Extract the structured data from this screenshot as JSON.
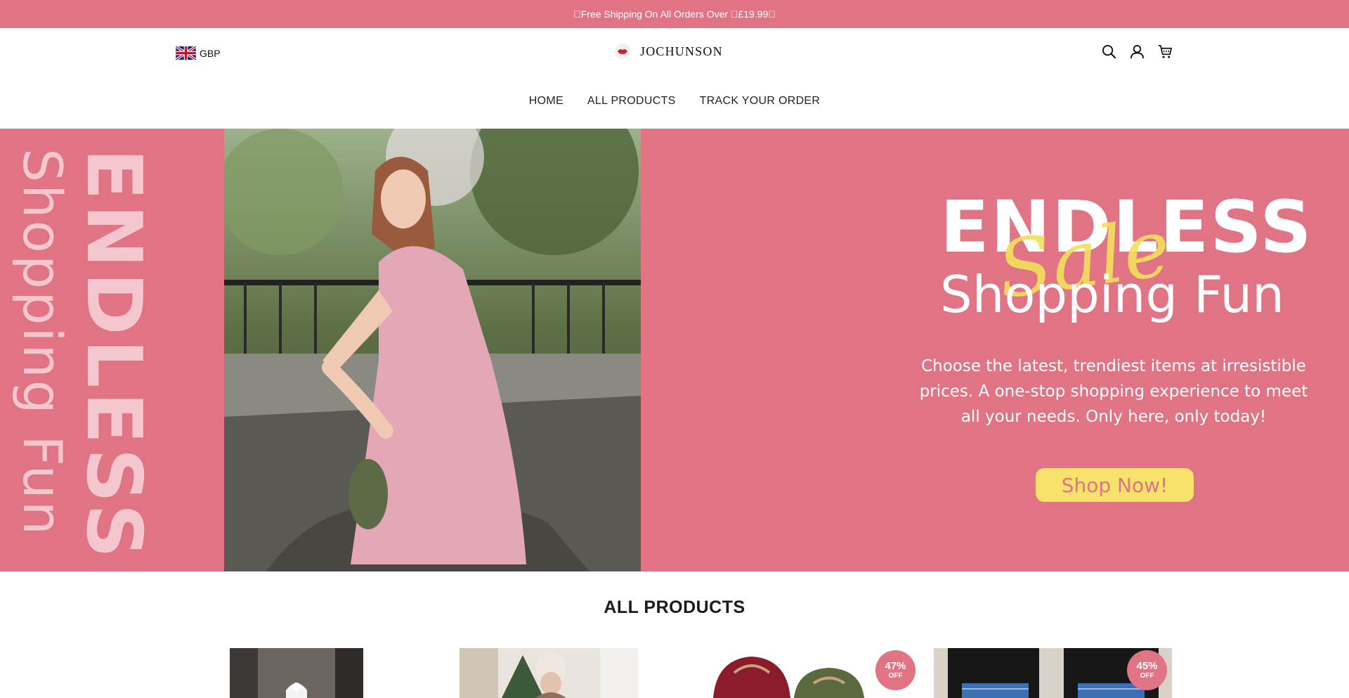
{
  "announcement": "\u0000Free Shipping On All Orders Over \u0000£19.99\u0000",
  "header": {
    "currency": "GBP",
    "logo_text": "JOCHUNSON"
  },
  "nav": {
    "items": [
      {
        "label": "HOME"
      },
      {
        "label": "ALL PRODUCTS"
      },
      {
        "label": "TRACK YOUR ORDER"
      }
    ]
  },
  "hero": {
    "side_big": "ENDLESS",
    "side_small": "Shopping Fun",
    "headline": "ENDLESS",
    "script": "Sale",
    "subheadline": "Shopping Fun",
    "description": "Choose the latest, trendiest items at irresistible prices. A one-stop shopping experience to meet all your needs. Only here, only today!",
    "cta_label": "Shop Now!"
  },
  "products": {
    "section_title": "ALL PRODUCTS",
    "items": [
      {
        "badge": null
      },
      {
        "badge": null
      },
      {
        "badge": {
          "percent": "47%",
          "off": "OFF"
        }
      },
      {
        "badge": {
          "percent": "45%",
          "off": "OFF"
        }
      }
    ]
  },
  "colors": {
    "brand_pink": "#e07384",
    "cta_yellow": "#f7e36c",
    "sale_yellow": "#f2df5c"
  }
}
